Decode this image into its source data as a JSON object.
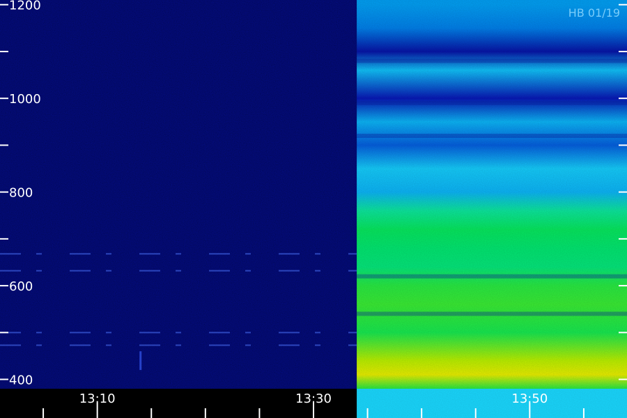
{
  "chart_data": {
    "type": "heatmap",
    "title": "",
    "stamp": "HB 01/19",
    "xlabel": "",
    "ylabel": "",
    "y_axis": {
      "ylim": [
        380,
        1210
      ],
      "major_ticks": [
        400,
        600,
        800,
        1000,
        1200
      ],
      "minor_ticks": [
        500,
        700,
        900,
        1100
      ],
      "tick_labels": [
        "400",
        "600",
        "800",
        "1000",
        "1200"
      ]
    },
    "x_axis": {
      "xlim": [
        "13:01",
        "13:59"
      ],
      "major_ticks": [
        "13:10",
        "13:30",
        "13:50"
      ],
      "tick_labels": [
        "13:10",
        "13:30",
        "13:50"
      ],
      "minor_tick_interval_min": 5
    },
    "time_boundary": "13:34",
    "colorscale": [
      "#00005a",
      "#0a1ec8",
      "#0096f0",
      "#20e6ff",
      "#00e664",
      "#78f000",
      "#e6f000",
      "#ff9600"
    ],
    "left_segment": {
      "label": "13:01-13:34",
      "background_level": 0.06,
      "narrowband_lines_y": [
        668,
        632,
        500,
        473
      ],
      "burst_x": "13:14",
      "burst_y_range": [
        420,
        460
      ]
    },
    "right_segment": {
      "label": "13:34-13:59",
      "intensity_profile": [
        {
          "y": 1200,
          "level": 0.3
        },
        {
          "y": 1150,
          "level": 0.26
        },
        {
          "y": 1100,
          "level": 0.1
        },
        {
          "y": 1060,
          "level": 0.36
        },
        {
          "y": 1000,
          "level": 0.12
        },
        {
          "y": 950,
          "level": 0.34
        },
        {
          "y": 900,
          "level": 0.22
        },
        {
          "y": 850,
          "level": 0.38
        },
        {
          "y": 800,
          "level": 0.34
        },
        {
          "y": 760,
          "level": 0.52
        },
        {
          "y": 720,
          "level": 0.58
        },
        {
          "y": 680,
          "level": 0.56
        },
        {
          "y": 640,
          "level": 0.55
        },
        {
          "y": 600,
          "level": 0.62
        },
        {
          "y": 560,
          "level": 0.64
        },
        {
          "y": 500,
          "level": 0.6
        },
        {
          "y": 440,
          "level": 0.8
        },
        {
          "y": 410,
          "level": 0.86
        },
        {
          "y": 380,
          "level": 0.62
        }
      ],
      "dark_band_y": [
        1080,
        990,
        920,
        620,
        540
      ],
      "bottom_strip_level": 0.4
    }
  }
}
